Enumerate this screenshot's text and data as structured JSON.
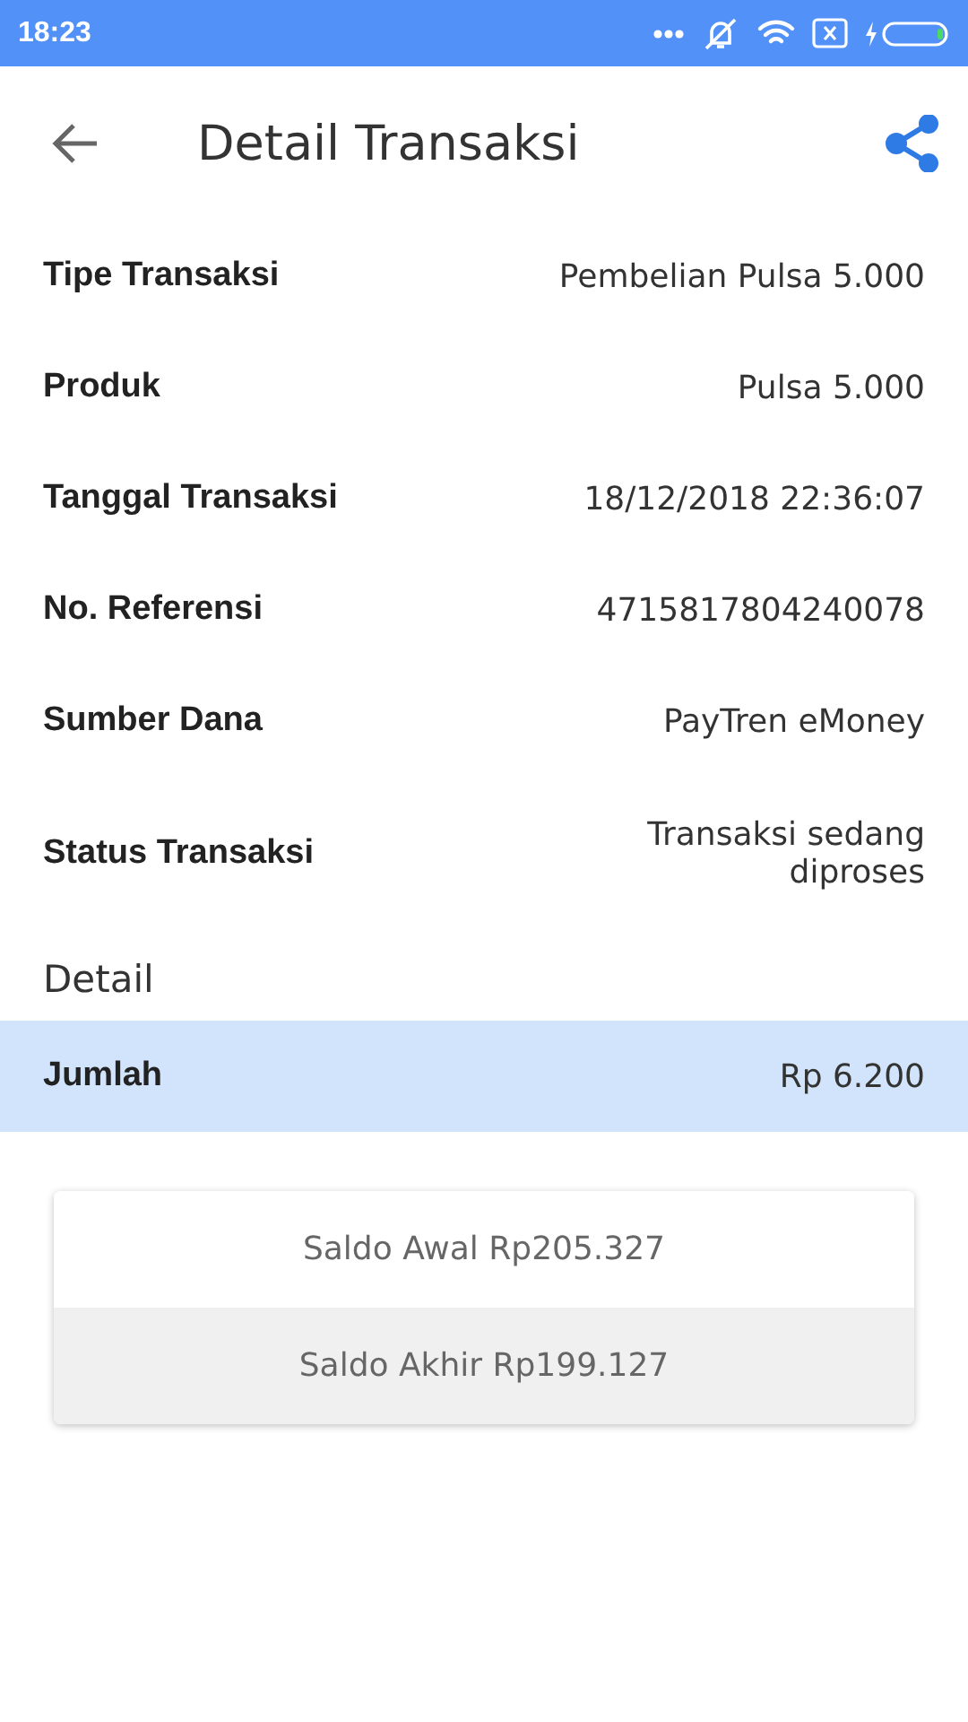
{
  "status_bar": {
    "time": "18:23"
  },
  "header": {
    "title": "Detail Transaksi"
  },
  "info_rows": [
    {
      "label": "Tipe Transaksi",
      "value": "Pembelian Pulsa 5.000"
    },
    {
      "label": "Produk",
      "value": "Pulsa 5.000"
    },
    {
      "label": "Tanggal Transaksi",
      "value": "18/12/2018 22:36:07"
    },
    {
      "label": "No. Referensi",
      "value": "4715817804240078"
    },
    {
      "label": "Sumber Dana",
      "value": "PayTren eMoney"
    },
    {
      "label": "Status Transaksi",
      "value": "Transaksi sedang diproses"
    }
  ],
  "detail_section": {
    "title": "Detail",
    "rows": [
      {
        "label": "Jumlah",
        "value": "Rp 6.200",
        "highlighted": true
      }
    ]
  },
  "balance_card": {
    "items": [
      {
        "text": "Saldo Awal Rp205.327",
        "kind": "plain"
      },
      {
        "text": "Saldo Akhir Rp199.127",
        "kind": "shaded"
      }
    ]
  }
}
